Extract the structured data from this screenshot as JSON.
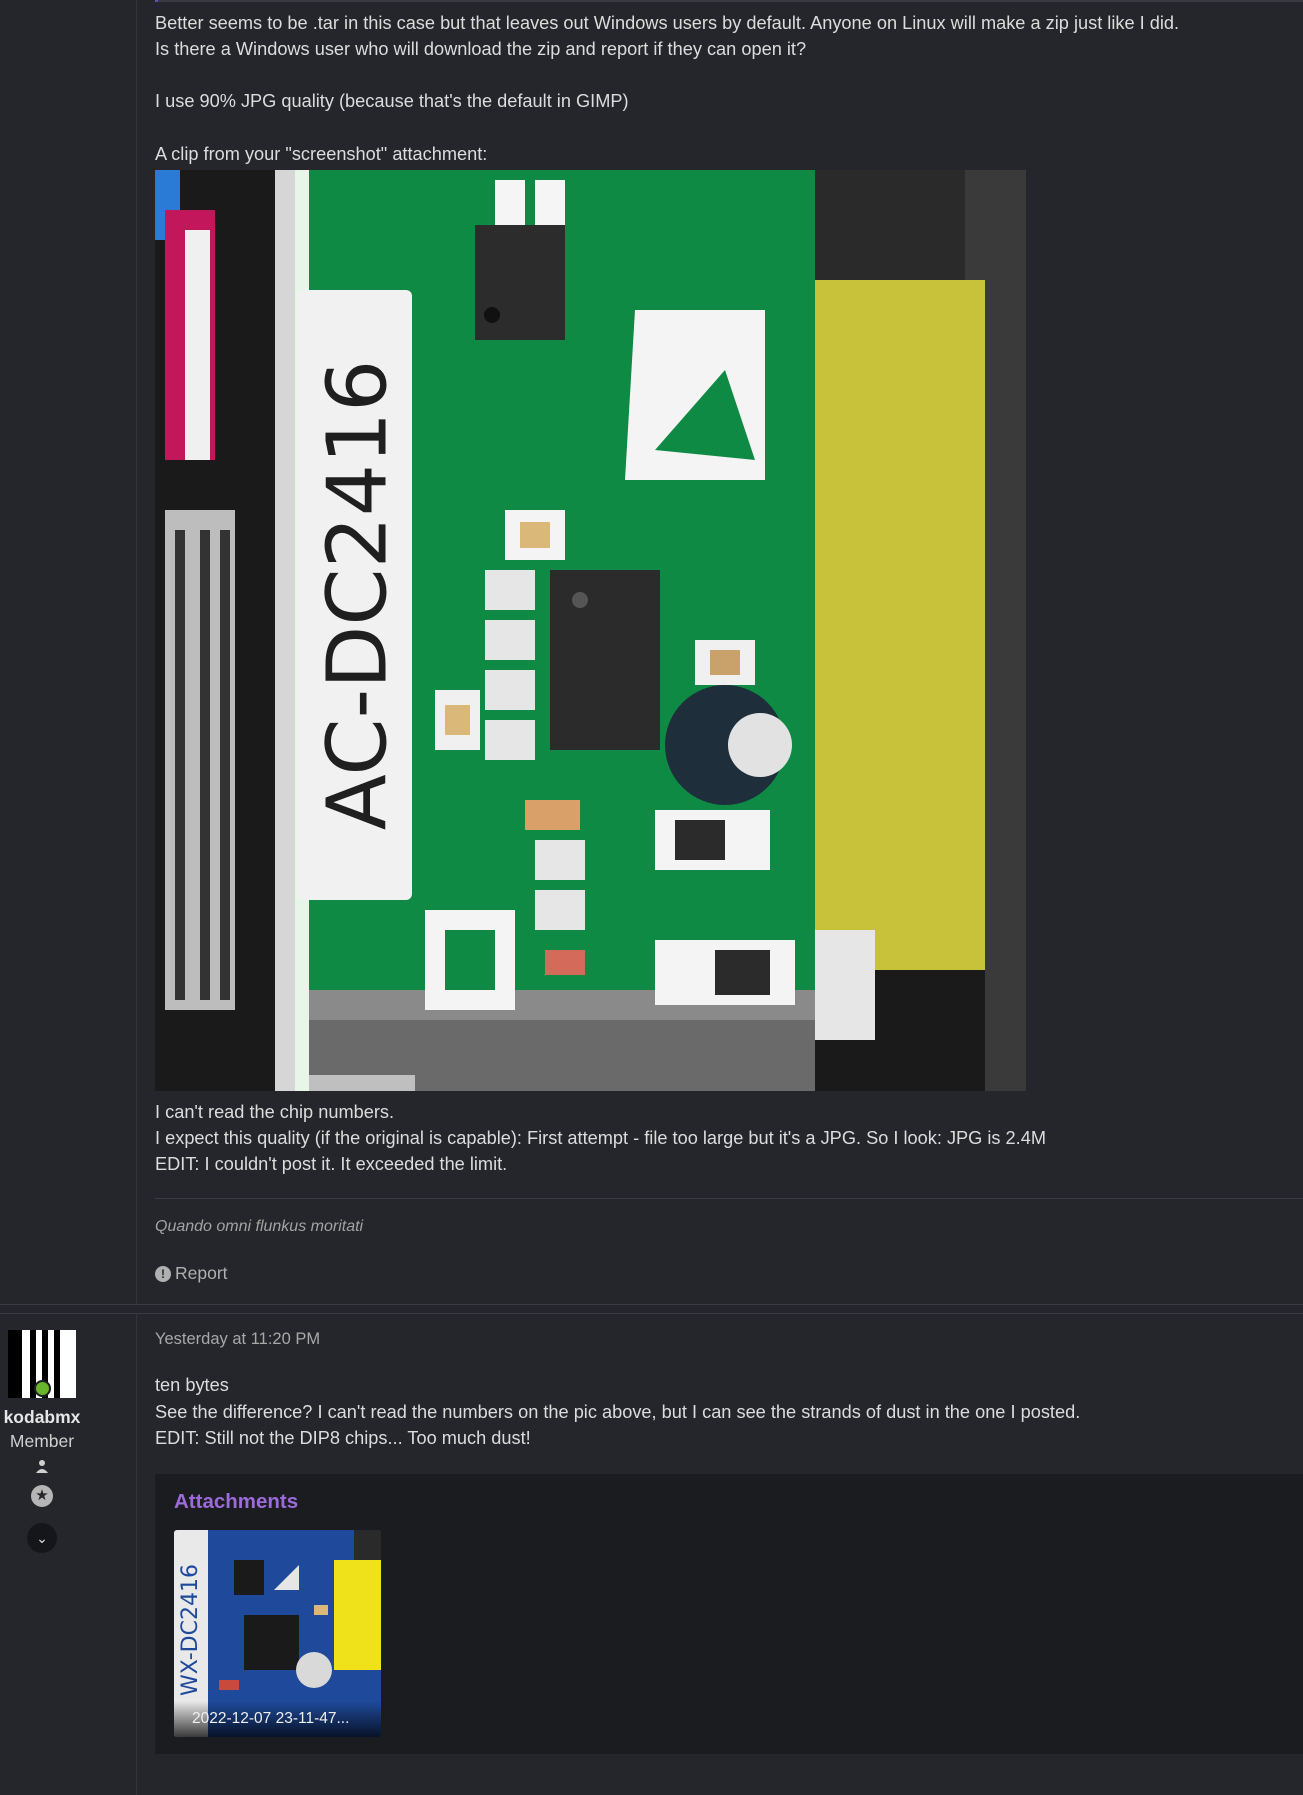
{
  "post1": {
    "lines_top": [
      "Better seems to be .tar in this case but that leaves out Windows users by default. Anyone on Linux will make a zip just like I did.",
      "Is there a Windows user who will download the zip and report if they can open it?"
    ],
    "quality_line": "I use 90% JPG quality (because that's the default in GIMP)",
    "clip_caption": "A clip from your \"screenshot\" attachment:",
    "image_label": "AC-DC2416",
    "lines_bottom": [
      "I can't read the chip numbers.",
      "I expect this quality (if the original is capable): First attempt - file too large but it's a JPG. So I look: JPG is 2.4M",
      "EDIT: I couldn't post it. It exceeded the limit."
    ],
    "signature": "Quando omni flunkus moritati",
    "report_label": "Report"
  },
  "post2": {
    "username": "kodabmx",
    "role": "Member",
    "timestamp": "Yesterday at 11:20 PM",
    "lines": [
      "ten bytes",
      "See the difference? I can't read the numbers on the pic above, but I can see the strands of dust in the one I posted.",
      "EDIT: Still not the DIP8 chips... Too much dust!"
    ],
    "attachments_title": "Attachments",
    "attachment": {
      "filename": "2022-12-07 23-11-47...",
      "image_label": "WX-DC2416"
    }
  },
  "colors": {
    "background": "#25262b",
    "attachments_bg": "#1b1c20",
    "accent_purple": "#9b6bd9",
    "online_green": "#67b52b",
    "pcb_green": "#0f8a45"
  },
  "icons": {
    "report": "exclamation-circle-icon",
    "user": "user-icon",
    "star": "star-badge-icon",
    "expand": "chevron-down-icon"
  }
}
